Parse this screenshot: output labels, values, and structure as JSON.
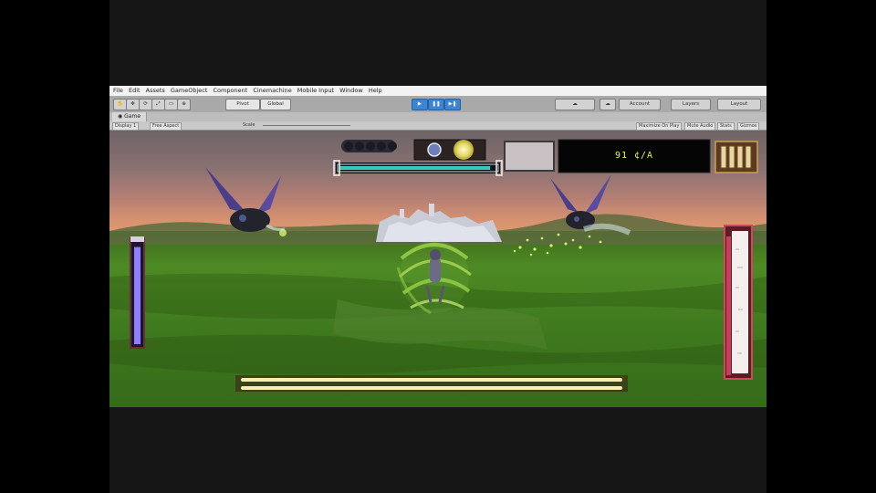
{
  "editor": {
    "menu": [
      "File",
      "Edit",
      "Assets",
      "GameObject",
      "Component",
      "Cinemachine",
      "Mobile Input",
      "Window",
      "Help"
    ],
    "toolbar": {
      "pivot_label": "Pivot",
      "global_label": "Global",
      "account_label": "Account",
      "layers_label": "Layers",
      "layout_label": "Layout"
    },
    "game_tab_label": "Game",
    "options": {
      "display_label": "Display 1",
      "aspect_label": "Free Aspect",
      "scale_label": "Scale",
      "maximize_label": "Maximize On Play",
      "mute_label": "Mute Audio",
      "stats_label": "Stats",
      "gizmos_label": "Gizmos"
    }
  },
  "hud": {
    "score_text": "91  ¢/A",
    "colors": {
      "stamina": "#36c9c3",
      "mana": "#8d7dff",
      "health": "#c93c5c",
      "charge": "#f6f0b0",
      "aura": "#9ad24a"
    },
    "stamina_fraction": 0.96,
    "charge_fraction": 1.0,
    "mana_fraction": 0.95,
    "health_fraction": 0.95
  }
}
